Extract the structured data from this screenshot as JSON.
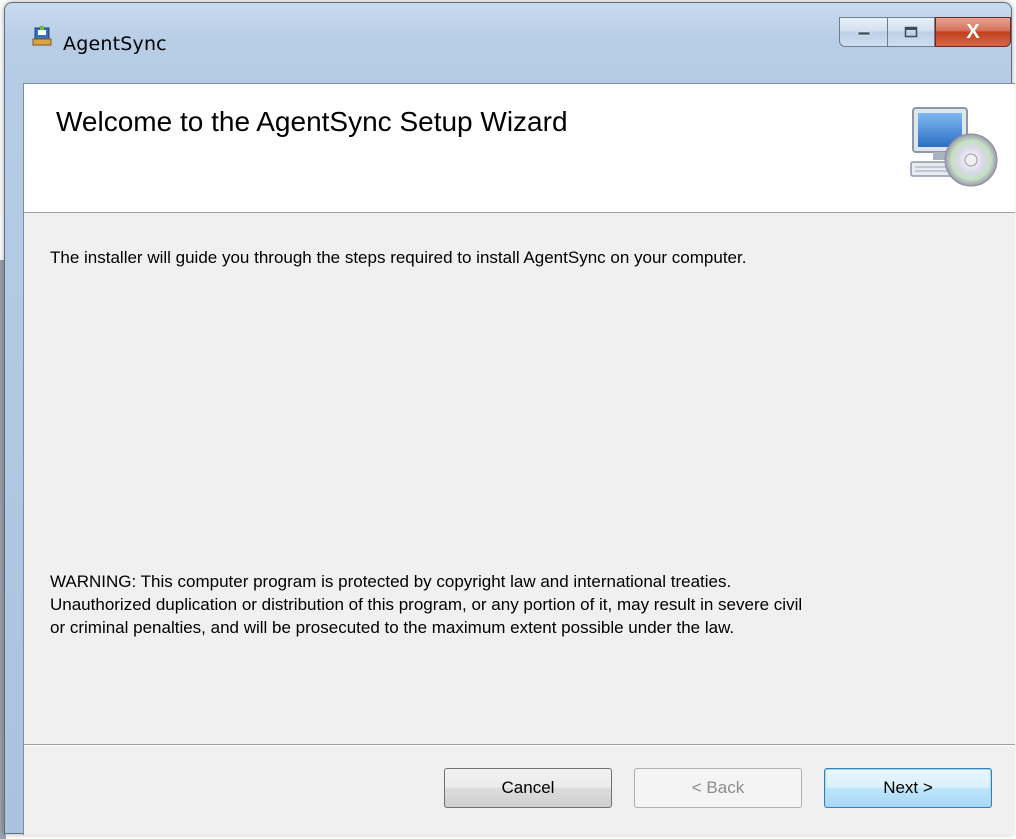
{
  "window": {
    "title": "AgentSync",
    "app_icon": "installer-package-icon",
    "caption_buttons": {
      "minimize_icon": "minimize-icon",
      "maximize_icon": "maximize-icon",
      "close_icon": "close-icon",
      "close_label": "X"
    }
  },
  "banner": {
    "title": "Welcome to the AgentSync Setup Wizard",
    "icon": "computer-with-disc-icon"
  },
  "body": {
    "intro": "The installer will guide you through the steps required to install AgentSync on your computer.",
    "warning_line1": "WARNING: This computer program is protected by copyright law and international treaties.",
    "warning_line2": "Unauthorized duplication or distribution of this program, or any portion of it, may result in severe civil",
    "warning_line3": "or criminal penalties, and will be prosecuted to the maximum extent possible under the law."
  },
  "footer": {
    "cancel_label": "Cancel",
    "back_label": "< Back",
    "next_label": "Next >"
  },
  "colors": {
    "frame": "#b7cde6",
    "client": "#f0f0f0",
    "close_button": "#c2401f",
    "default_button_border": "#3c7fb1"
  }
}
